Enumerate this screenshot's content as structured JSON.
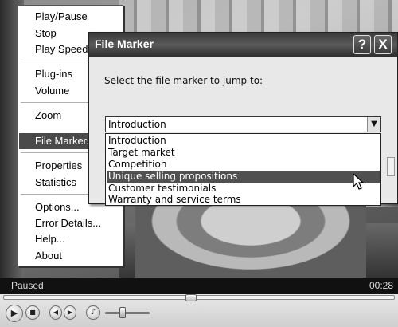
{
  "context_menu": {
    "groups": [
      [
        "Play/Pause",
        "Stop",
        "Play Speed"
      ],
      [
        "Plug-ins",
        "Volume"
      ],
      [
        "Zoom"
      ],
      [
        "File Markers"
      ],
      [
        "Properties",
        "Statistics"
      ],
      [
        "Options...",
        "Error Details...",
        "Help...",
        "About"
      ]
    ],
    "items": {
      "play_pause": "Play/Pause",
      "stop": "Stop",
      "play_speed": "Play Speed",
      "plug_ins": "Plug-ins",
      "volume": "Volume",
      "zoom": "Zoom",
      "file_markers": "File Markers",
      "properties": "Properties",
      "statistics": "Statistics",
      "options": "Options...",
      "error_details": "Error Details...",
      "help": "Help...",
      "about": "About"
    },
    "active_item": "File Markers"
  },
  "dialog": {
    "title": "File Marker",
    "help_button": "?",
    "close_button": "X",
    "prompt": "Select the file marker to jump to:",
    "selected_value": "Introduction",
    "options": [
      "Introduction",
      "Target market",
      "Competition",
      "Unique selling propositions",
      "Customer testimonials",
      "Warranty and service terms"
    ],
    "highlighted_option": "Unique selling propositions"
  },
  "player": {
    "status": "Paused",
    "time": "00:28",
    "seek_position_fraction": 0.48,
    "volume_fraction": 0.38
  }
}
